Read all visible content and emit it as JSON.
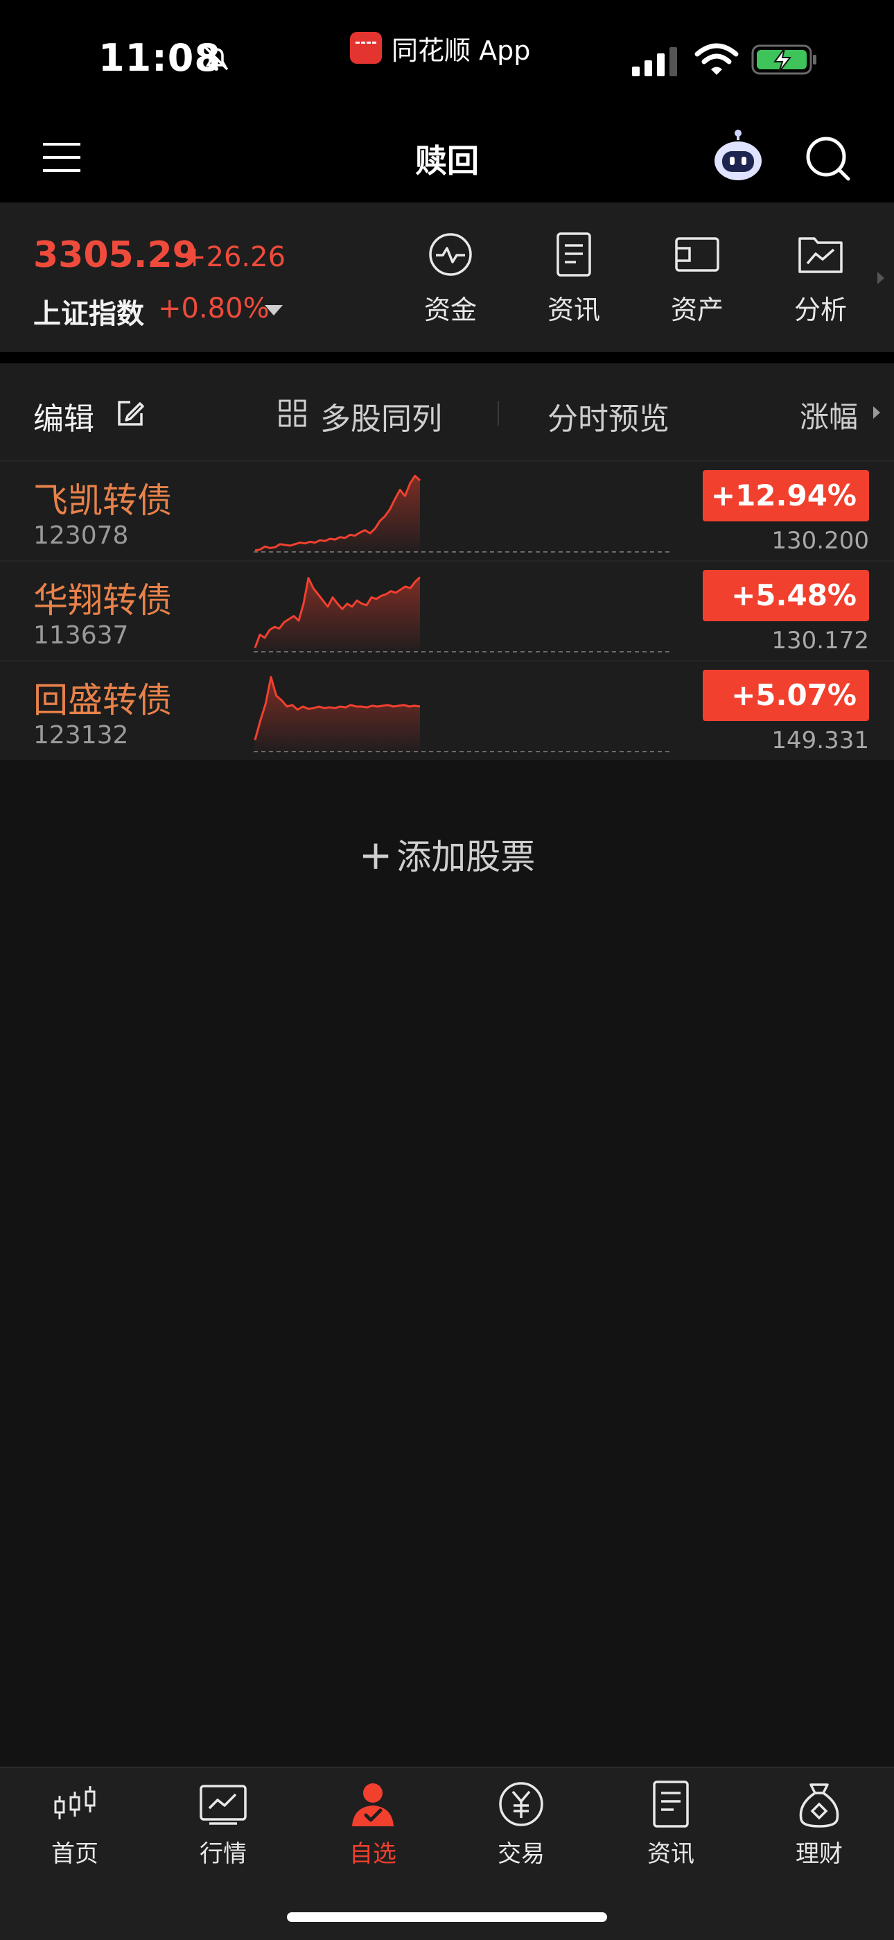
{
  "status_bar": {
    "time": "11:08",
    "app_name": "同花顺 App"
  },
  "header": {
    "title": "赎回"
  },
  "index": {
    "price": "3305.29",
    "change": "+26.26",
    "name": "上证指数",
    "change_pct": "+0.80%"
  },
  "quick_actions": [
    {
      "label": "资金",
      "icon": "pulse-circle-icon"
    },
    {
      "label": "资讯",
      "icon": "document-icon"
    },
    {
      "label": "资产",
      "icon": "wallet-icon"
    },
    {
      "label": "分析",
      "icon": "chart-folder-icon"
    }
  ],
  "toolbar": {
    "edit": "编辑",
    "multi": "多股同列",
    "preview": "分时预览",
    "sort": "涨幅"
  },
  "stocks": [
    {
      "name": "飞凯转债",
      "code": "123078",
      "change_pct": "+12.94%",
      "price": "130.200",
      "trend": [
        0.02,
        0.03,
        0.07,
        0.05,
        0.06,
        0.1,
        0.09,
        0.08,
        0.1,
        0.12,
        0.11,
        0.13,
        0.12,
        0.15,
        0.14,
        0.17,
        0.16,
        0.19,
        0.18,
        0.22,
        0.21,
        0.25,
        0.28,
        0.24,
        0.3,
        0.4,
        0.46,
        0.55,
        0.68,
        0.8,
        0.72,
        0.88,
        0.98,
        0.92
      ]
    },
    {
      "name": "华翔转债",
      "code": "113637",
      "change_pct": "+5.48%",
      "price": "130.172",
      "trend": [
        0.05,
        0.22,
        0.18,
        0.28,
        0.32,
        0.3,
        0.38,
        0.42,
        0.46,
        0.4,
        0.62,
        0.95,
        0.82,
        0.74,
        0.66,
        0.58,
        0.7,
        0.62,
        0.55,
        0.62,
        0.58,
        0.66,
        0.62,
        0.6,
        0.7,
        0.68,
        0.72,
        0.74,
        0.78,
        0.76,
        0.8,
        0.84,
        0.82,
        0.9,
        0.96
      ]
    },
    {
      "name": "回盛转债",
      "code": "123132",
      "change_pct": "+5.07%",
      "price": "149.331",
      "trend": [
        0.15,
        0.4,
        0.62,
        0.96,
        0.72,
        0.66,
        0.58,
        0.6,
        0.54,
        0.58,
        0.55,
        0.56,
        0.58,
        0.56,
        0.57,
        0.56,
        0.58,
        0.57,
        0.6,
        0.58,
        0.58,
        0.57,
        0.59,
        0.58,
        0.59,
        0.6,
        0.58,
        0.59,
        0.6,
        0.58,
        0.59,
        0.58
      ]
    }
  ],
  "add_stock": "添加股票",
  "bottom_nav": [
    {
      "label": "首页",
      "icon": "candlestick-icon",
      "active": false
    },
    {
      "label": "行情",
      "icon": "chart-board-icon",
      "active": false
    },
    {
      "label": "自选",
      "icon": "user-check-icon",
      "active": true
    },
    {
      "label": "交易",
      "icon": "yen-circle-icon",
      "active": false
    },
    {
      "label": "资讯",
      "icon": "news-doc-icon",
      "active": false
    },
    {
      "label": "理财",
      "icon": "money-bag-icon",
      "active": false
    }
  ],
  "colors": {
    "up": "#f2402f",
    "accent_name": "#e8824a",
    "background": "#131313"
  }
}
